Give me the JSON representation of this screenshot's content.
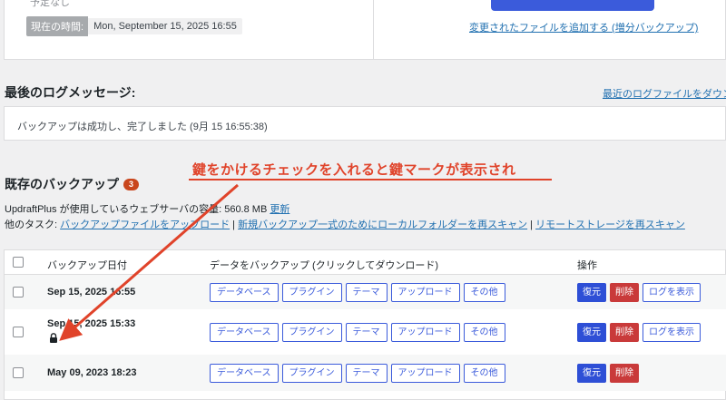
{
  "top": {
    "cut_text": "予定なし",
    "time_label": "現在の時間:",
    "time_value": "Mon, September 15, 2025 16:55",
    "incremental_link": "変更されたファイルを追加する (増分バックアップ)"
  },
  "log": {
    "title": "最後のログメッセージ:",
    "recent_link": "最近のログファイルをダウンロード",
    "message": "バックアップは成功し、完了しました (9月 15 16:55:38)"
  },
  "existing": {
    "title": "既存のバックアップ",
    "count": "3",
    "usage_prefix": "UpdraftPlus が使用しているウェブサーバの容量: ",
    "usage_value": "560.8 MB",
    "refresh_link": "更新",
    "tasks_prefix": "他のタスク: ",
    "task_upload": "バックアップファイルをアップロード",
    "task_rescan_local": "新規バックアップ一式のためにローカルフォルダーを再スキャン",
    "task_rescan_remote": "リモートストレージを再スキャン",
    "separator": " | "
  },
  "table": {
    "headers": {
      "date": "バックアップ日付",
      "data": "データをバックアップ (クリックしてダウンロード)",
      "actions": "操作"
    },
    "rows": [
      {
        "date": "Sep 15, 2025 16:55",
        "locked": false,
        "show_log": true
      },
      {
        "date": "Sep 15, 2025 15:33",
        "locked": true,
        "show_log": true
      },
      {
        "date": "May 09, 2023 18:23",
        "locked": false,
        "show_log": false
      }
    ],
    "pills": [
      "データベース",
      "プラグイン",
      "テーマ",
      "アップロード",
      "その他"
    ],
    "restore_label": "復元",
    "delete_label": "削除",
    "log_label": "ログを表示"
  },
  "annotation": {
    "text": "鍵をかけるチェックを入れると鍵マークが表示され"
  },
  "colors": {
    "accent": "#3b5bdb",
    "danger": "#c93a3a",
    "annotation": "#e0432a",
    "badge": "#c9461d"
  }
}
